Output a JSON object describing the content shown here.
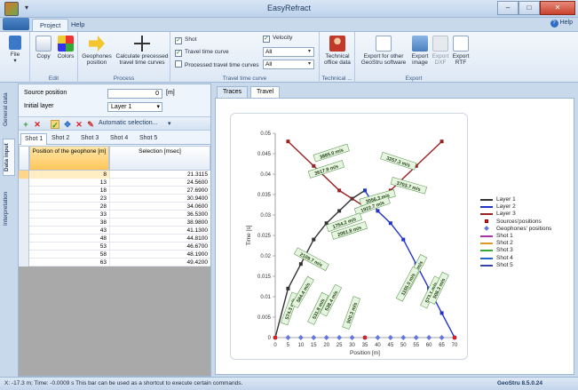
{
  "window": {
    "title": "EasyRefract",
    "minimize": "–",
    "maximize": "□",
    "close": "✕"
  },
  "ribbon_tabs": [
    "Project",
    "Help"
  ],
  "help_label": "Help",
  "ribbon": {
    "file": {
      "label": "File",
      "group": ""
    },
    "edit": {
      "copy": "Copy",
      "colors": "Colors",
      "group": "Edit"
    },
    "process": {
      "geophones_position": "Geophones position",
      "calc_curves": "Calculate precessed travel time curves",
      "group": "Process"
    },
    "ttc": {
      "shot": "Shot",
      "velocity": "Velocity",
      "travel_time_curve": "Travel time curve",
      "processed_ttc": "Processed travel time curves",
      "combo1": "All",
      "combo2": "All",
      "group": "Travel time curve"
    },
    "technical": {
      "office_data": "Technical office data",
      "group": "Technical ..."
    },
    "export": {
      "geostru": "Export for other GeoStru software",
      "image": "Export image",
      "dxf": "Export DXF",
      "rtf": "Export RTF",
      "group": "Export"
    }
  },
  "vertical_tabs": [
    "General data",
    "Data input",
    "Interpretation"
  ],
  "left_panel": {
    "source_position_label": "Source position",
    "source_position_value": "0",
    "source_position_unit": "[m]",
    "initial_layer_label": "Initial layer",
    "initial_layer_value": "Layer 1",
    "auto_selection": "Automatic selection...",
    "shot_tabs": [
      "Shot 1",
      "Shot 2",
      "Shot 3",
      "Shot 4",
      "Shot 5"
    ],
    "grid_headers": {
      "position": "Position of the geophone [m]",
      "selection": "Selection [msec]"
    },
    "rows": [
      {
        "pos": "8",
        "sel": "21.3115"
      },
      {
        "pos": "13",
        "sel": "24.5600"
      },
      {
        "pos": "18",
        "sel": "27.6900"
      },
      {
        "pos": "23",
        "sel": "30.9400"
      },
      {
        "pos": "28",
        "sel": "34.0600"
      },
      {
        "pos": "33",
        "sel": "36.5300"
      },
      {
        "pos": "38",
        "sel": "38.9800"
      },
      {
        "pos": "43",
        "sel": "41.1300"
      },
      {
        "pos": "48",
        "sel": "44.8100"
      },
      {
        "pos": "53",
        "sel": "46.6700"
      },
      {
        "pos": "58",
        "sel": "48.1900"
      },
      {
        "pos": "63",
        "sel": "49.4200"
      }
    ]
  },
  "content_tabs": [
    "Traces",
    "Travel time curve"
  ],
  "status": {
    "text": "X: -17.3 m; Time: -0.0009 s  This bar can be used as a shortcut to execute certain commands.",
    "version": "GeoStru 8.5.0.24"
  },
  "chart_data": {
    "type": "line",
    "xlabel": "Position [m]",
    "ylabel": "Time [s]",
    "xlim": [
      0,
      70
    ],
    "ylim": [
      0,
      0.05
    ],
    "x_ticks": [
      "0",
      "5",
      "10",
      "15",
      "20",
      "25",
      "30",
      "35",
      "40",
      "45",
      "50",
      "55",
      "60",
      "65",
      "70"
    ],
    "y_ticks": [
      "0",
      "0.005",
      "0.01",
      "0.015",
      "0.02",
      "0.025",
      "0.03",
      "0.035",
      "0.04",
      "0.045",
      "0.05"
    ],
    "legend": [
      "Layer 1",
      "Layer 2",
      "Layer 3",
      "Sources'positions",
      "Geophones' positions",
      "Shot 1",
      "Shot 2",
      "Shot 3",
      "Shot 4",
      "Shot 5"
    ],
    "colors": [
      "#333333",
      "#2233cc",
      "#992222",
      "#dd2222",
      "#6677dd",
      "#aa33aa",
      "#dd9922",
      "#33aa33",
      "#2266cc",
      "#3344aa"
    ],
    "series": [
      {
        "name": "Layer 1",
        "x": [
          0,
          5,
          10,
          15,
          20,
          25,
          30,
          35
        ],
        "y": [
          0,
          0.012,
          0.018,
          0.024,
          0.028,
          0.031,
          0.034,
          0.036
        ]
      },
      {
        "name": "Layer 2",
        "x": [
          35,
          40,
          45,
          50,
          55,
          60,
          65,
          70
        ],
        "y": [
          0.036,
          0.031,
          0.028,
          0.024,
          0.018,
          0.012,
          0.006,
          0
        ]
      },
      {
        "name": "Layer 3",
        "x": [
          5,
          15,
          25,
          35,
          45,
          55,
          65
        ],
        "y": [
          0.048,
          0.042,
          0.036,
          0.032,
          0.036,
          0.042,
          0.048
        ]
      }
    ],
    "velocity_labels": [
      "3885.0 m/s",
      "3617.9 m/s",
      "3257.3 m/s",
      "3056.3 m/s",
      "3703.7 m/s",
      "1922.7 m/s",
      "1754.2 m/s",
      "2061.8 m/s",
      "2109.7 m/s",
      "1185.9 m/s",
      "1155.0 m/s",
      "573.1 m/s",
      "508.3 m/s",
      "574.3 m/s",
      "584.4 m/s",
      "531.8 m/s",
      "538.4 m/s",
      "500.3 m/s"
    ]
  }
}
